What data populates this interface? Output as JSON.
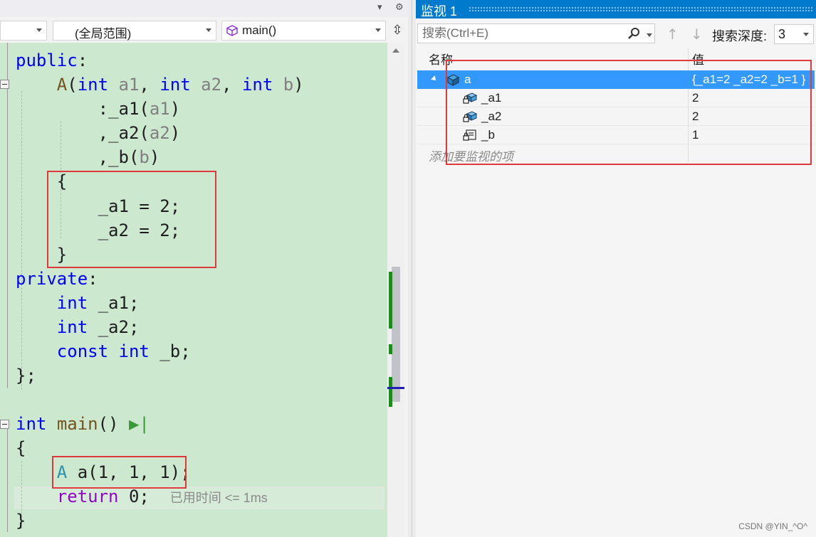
{
  "editor": {
    "nav": {
      "scope_combo": "(全局范围)",
      "member_combo": "main()"
    },
    "code_lines": [
      {
        "tokens": [
          {
            "t": "kw",
            "s": "public"
          },
          {
            "t": "",
            "s": ":"
          }
        ]
      },
      {
        "tokens": [
          {
            "t": "",
            "s": "    "
          },
          {
            "t": "fn",
            "s": "A"
          },
          {
            "t": "",
            "s": "("
          },
          {
            "t": "kw",
            "s": "int"
          },
          {
            "t": "",
            "s": " "
          },
          {
            "t": "pa",
            "s": "a1"
          },
          {
            "t": "",
            "s": ", "
          },
          {
            "t": "kw",
            "s": "int"
          },
          {
            "t": "",
            "s": " "
          },
          {
            "t": "pa",
            "s": "a2"
          },
          {
            "t": "",
            "s": ", "
          },
          {
            "t": "kw",
            "s": "int"
          },
          {
            "t": "",
            "s": " "
          },
          {
            "t": "pa",
            "s": "b"
          },
          {
            "t": "",
            "s": ")"
          }
        ]
      },
      {
        "tokens": [
          {
            "t": "",
            "s": "        :_a1("
          },
          {
            "t": "pa",
            "s": "a1"
          },
          {
            "t": "",
            "s": ")"
          }
        ]
      },
      {
        "tokens": [
          {
            "t": "",
            "s": "        ,_a2("
          },
          {
            "t": "pa",
            "s": "a2"
          },
          {
            "t": "",
            "s": ")"
          }
        ]
      },
      {
        "tokens": [
          {
            "t": "",
            "s": "        ,_b("
          },
          {
            "t": "pa",
            "s": "b"
          },
          {
            "t": "",
            "s": ")"
          }
        ]
      },
      {
        "tokens": [
          {
            "t": "",
            "s": "    {"
          }
        ]
      },
      {
        "tokens": [
          {
            "t": "",
            "s": "        _a1 = 2;"
          }
        ]
      },
      {
        "tokens": [
          {
            "t": "",
            "s": "        _a2 = 2;"
          }
        ]
      },
      {
        "tokens": [
          {
            "t": "",
            "s": "    }"
          }
        ]
      },
      {
        "tokens": [
          {
            "t": "kw",
            "s": "private"
          },
          {
            "t": "",
            "s": ":"
          }
        ]
      },
      {
        "tokens": [
          {
            "t": "",
            "s": "    "
          },
          {
            "t": "kw",
            "s": "int"
          },
          {
            "t": "",
            "s": " _a1;"
          }
        ]
      },
      {
        "tokens": [
          {
            "t": "",
            "s": "    "
          },
          {
            "t": "kw",
            "s": "int"
          },
          {
            "t": "",
            "s": " _a2;"
          }
        ]
      },
      {
        "tokens": [
          {
            "t": "",
            "s": "    "
          },
          {
            "t": "kw",
            "s": "const"
          },
          {
            "t": "",
            "s": " "
          },
          {
            "t": "kw",
            "s": "int"
          },
          {
            "t": "",
            "s": " _b;"
          }
        ]
      },
      {
        "tokens": [
          {
            "t": "",
            "s": "};"
          }
        ]
      },
      {
        "tokens": []
      },
      {
        "tokens": [
          {
            "t": "kw",
            "s": "int"
          },
          {
            "t": "",
            "s": " "
          },
          {
            "t": "fn",
            "s": "main"
          },
          {
            "t": "",
            "s": "() "
          },
          {
            "t": "run",
            "s": "▶|"
          }
        ]
      },
      {
        "tokens": [
          {
            "t": "",
            "s": "{"
          }
        ]
      },
      {
        "tokens": [
          {
            "t": "",
            "s": "    "
          },
          {
            "t": "ty",
            "s": "A"
          },
          {
            "t": "",
            "s": " a(1, 1, 1);"
          }
        ]
      },
      {
        "tokens": [
          {
            "t": "",
            "s": "    "
          },
          {
            "t": "cf",
            "s": "return"
          },
          {
            "t": "",
            "s": " 0;  "
          },
          {
            "t": "elapsed",
            "s": "已用时间 <= 1ms"
          }
        ]
      },
      {
        "tokens": [
          {
            "t": "",
            "s": "}"
          }
        ]
      }
    ]
  },
  "watch": {
    "title": "监视 1",
    "search_placeholder": "搜索(Ctrl+E)",
    "depth_label": "搜索深度:",
    "depth_value": "3",
    "columns": {
      "name": "名称",
      "value": "值"
    },
    "rows": [
      {
        "name": "a",
        "value": "{_a1=2 _a2=2 _b=1 }",
        "icon": "object-icon",
        "selected": true,
        "expanded": true,
        "indent": 0
      },
      {
        "name": "_a1",
        "value": "2",
        "icon": "private-field-icon",
        "selected": false,
        "indent": 1
      },
      {
        "name": "_a2",
        "value": "2",
        "icon": "private-field-icon",
        "selected": false,
        "indent": 1
      },
      {
        "name": "_b",
        "value": "1",
        "icon": "private-const-field-icon",
        "selected": false,
        "indent": 1
      }
    ],
    "add_item_placeholder": "添加要监视的项"
  },
  "credit": "CSDN @YIN_^O^",
  "colors": {
    "editor_bg": "#cce8cf",
    "keyword": "#0000ff",
    "type": "#2b91af",
    "function": "#74531f",
    "parameter": "#808080",
    "control_flow": "#8f08c4",
    "accent": "#007acc",
    "selection": "#3399ff",
    "highlight_box": "#e0393b"
  }
}
